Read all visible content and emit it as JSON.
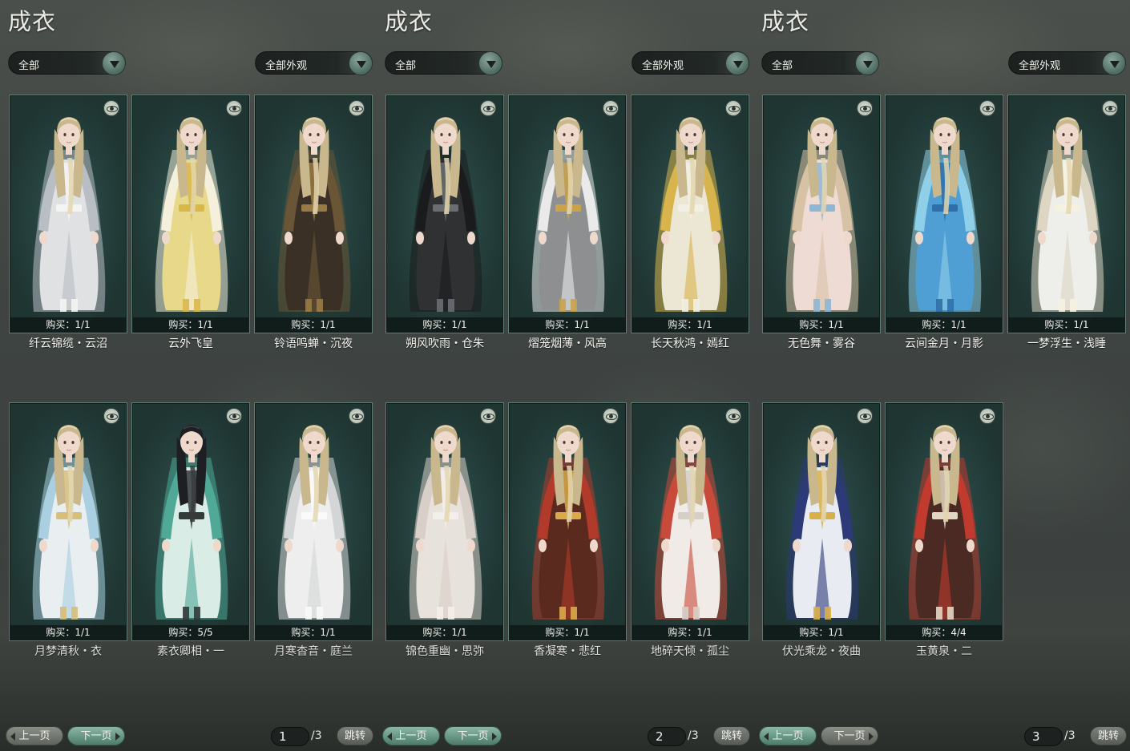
{
  "colors": {
    "card_bg": "#25403d",
    "card_border": "#5e7c73",
    "accent_green": "#4d7c6a",
    "panel_bg": "#3f4442"
  },
  "panels": [
    {
      "title": "成衣",
      "category_filter": "全部",
      "appearance_filter": "全部外观",
      "page_current": "1",
      "page_total": "/3",
      "prev_label": "上一页",
      "next_label": "下一页",
      "jump_label": "跳转",
      "items": [
        {
          "name": "纤云锦缆・云沼",
          "purchase": "购买：1/1",
          "palette": {
            "robe": "#dfe1e3",
            "trim": "#b9bec4",
            "accent": "#f4f4f2"
          }
        },
        {
          "name": "云外飞皇",
          "purchase": "购买：1/1",
          "palette": {
            "robe": "#e8d88a",
            "trim": "#f4f0dc",
            "accent": "#d9b84a"
          }
        },
        {
          "name": "铃语鸣蝉・沉夜",
          "purchase": "购买：1/1",
          "palette": {
            "robe": "#3a3026",
            "trim": "#6a5636",
            "accent": "#9a7a44"
          }
        },
        {
          "name": "月梦清秋・衣",
          "purchase": "购买：1/1",
          "palette": {
            "robe": "#e9eef0",
            "trim": "#a9cfe0",
            "accent": "#d7be7a"
          }
        },
        {
          "name": "素衣卿相・一",
          "purchase": "购买：5/5",
          "palette": {
            "robe": "#d9ece6",
            "trim": "#4fa996",
            "accent": "#333a38"
          },
          "dark_hair": true
        },
        {
          "name": "月寒杳音・庭兰",
          "purchase": "购买：1/1",
          "palette": {
            "robe": "#eeeeee",
            "trim": "#d3d5d6",
            "accent": "#fafafa"
          }
        }
      ]
    },
    {
      "title": "成衣",
      "category_filter": "全部",
      "appearance_filter": "全部外观",
      "page_current": "2",
      "page_total": "/3",
      "prev_label": "上一页",
      "next_label": "下一页",
      "jump_label": "跳转",
      "items": [
        {
          "name": "朔风吹雨・仓朱",
          "purchase": "购买：1/1",
          "palette": {
            "robe": "#2f3133",
            "trim": "#1a1b1c",
            "accent": "#6a6e72"
          }
        },
        {
          "name": "熠笼烟薄・风高",
          "purchase": "购买：1/1",
          "palette": {
            "robe": "#8d8f91",
            "trim": "#eaeaea",
            "accent": "#c9a24a"
          }
        },
        {
          "name": "长天秋鸿・嫣红",
          "purchase": "购买：1/1",
          "palette": {
            "robe": "#ece6d4",
            "trim": "#d8b44c",
            "accent": "#f2efe4"
          }
        },
        {
          "name": "锦色重幽・思弥",
          "purchase": "购买：1/1",
          "palette": {
            "robe": "#e8e2dc",
            "trim": "#d8cfc8",
            "accent": "#f3efea"
          }
        },
        {
          "name": "香凝寒・悲红",
          "purchase": "购买：1/1",
          "palette": {
            "robe": "#5a2a1e",
            "trim": "#b23a2a",
            "accent": "#d8aa4a"
          }
        },
        {
          "name": "地碎天倾・孤尘",
          "purchase": "购买：1/1",
          "palette": {
            "robe": "#f0ebe6",
            "trim": "#c84a3a",
            "accent": "#d6cfc8"
          }
        }
      ]
    },
    {
      "title": "成衣",
      "category_filter": "全部",
      "appearance_filter": "全部外观",
      "page_current": "3",
      "page_total": "/3",
      "prev_label": "上一页",
      "next_label": "下一页",
      "jump_label": "跳转",
      "items": [
        {
          "name": "无色舞・雾谷",
          "purchase": "购买：1/1",
          "palette": {
            "robe": "#eedcd4",
            "trim": "#d8c2a6",
            "accent": "#8fb6d4"
          }
        },
        {
          "name": "云间金月・月影",
          "purchase": "购买：1/1",
          "palette": {
            "robe": "#4f9fd4",
            "trim": "#8fd0e8",
            "accent": "#2f6ea8"
          }
        },
        {
          "name": "一梦浮生・浅睡",
          "purchase": "购买：1/1",
          "palette": {
            "robe": "#eeeeea",
            "trim": "#dcd6c2",
            "accent": "#f6f2e0"
          }
        },
        {
          "name": "伏光乘龙・夜曲",
          "purchase": "购买：1/1",
          "palette": {
            "robe": "#e8ecf2",
            "trim": "#2c3a78",
            "accent": "#d8b04a"
          }
        },
        {
          "name": "玉黄泉・二",
          "purchase": "购买：4/4",
          "palette": {
            "robe": "#4a2a22",
            "trim": "#c03a2e",
            "accent": "#e2d6c4"
          }
        }
      ]
    }
  ]
}
